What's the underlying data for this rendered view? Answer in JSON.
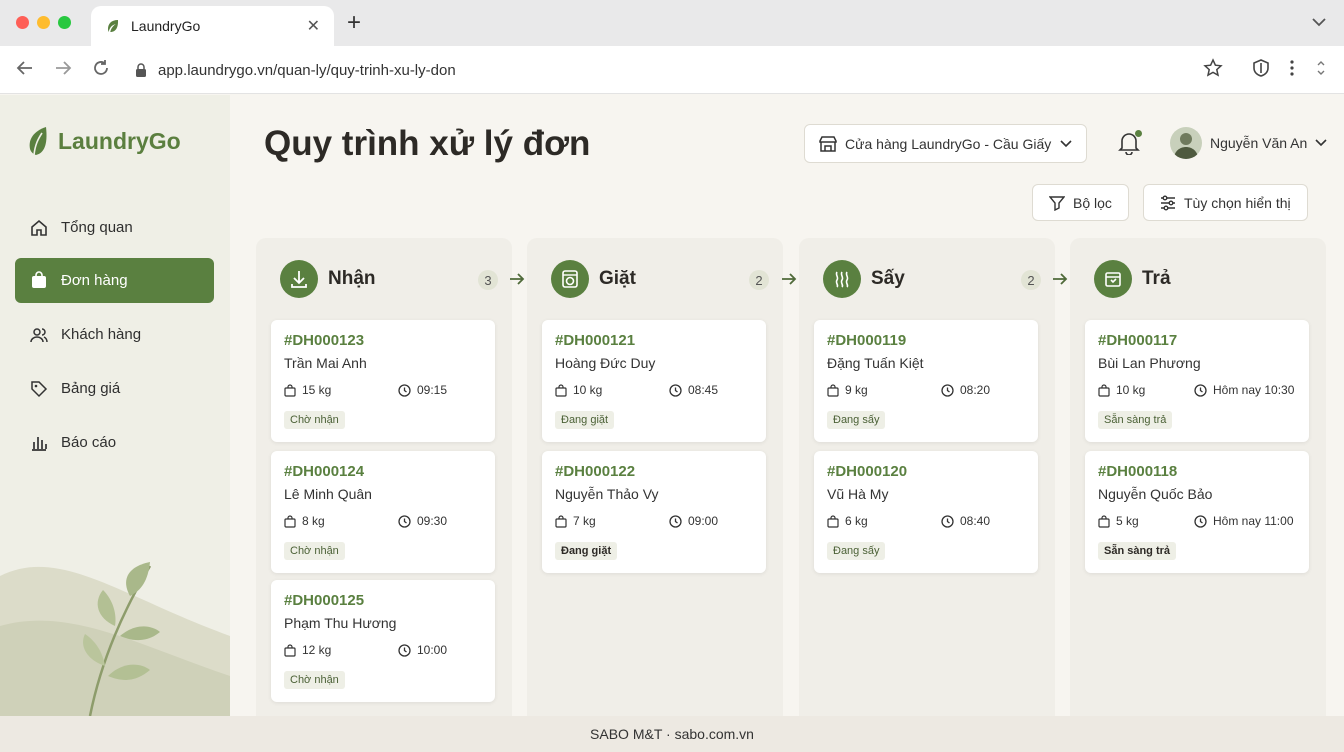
{
  "browser": {
    "tab_title": "LaundryGo",
    "url": "app.laundrygo.vn/quan-ly/quy-trinh-xu-ly-don"
  },
  "sidebar": {
    "logo": "LaundryGo",
    "items": [
      {
        "label": "Tổng quan",
        "icon": "home-icon"
      },
      {
        "label": "Đơn hàng",
        "icon": "bag-icon",
        "active": true
      },
      {
        "label": "Khách hàng",
        "icon": "users-icon"
      },
      {
        "label": "Bảng giá",
        "icon": "tag-icon"
      },
      {
        "label": "Báo cáo",
        "icon": "bar-chart-icon"
      }
    ]
  },
  "header": {
    "title": "Quy trình xử lý đơn",
    "store": "Cửa hàng LaundryGo - Cầu Giấy",
    "user": "Nguyễn Văn An",
    "filter_label": "Bộ lọc",
    "display_label": "Tùy chọn hiển thị"
  },
  "columns": [
    {
      "name": "Nhận",
      "count": "3",
      "icon": "download-icon",
      "cards": [
        {
          "code": "#DH000123",
          "customer": "Trần Mai Anh",
          "weight": "15 kg",
          "time": "09:15",
          "status": "Chờ nhận"
        },
        {
          "code": "#DH000124",
          "customer": "Lê Minh Quân",
          "weight": "8 kg",
          "time": "09:30",
          "status": "Chờ nhận"
        },
        {
          "code": "#DH000125",
          "customer": "Phạm Thu Hương",
          "weight": "12 kg",
          "time": "10:00",
          "status": "Chờ nhận"
        }
      ]
    },
    {
      "name": "Giặt",
      "count": "2",
      "icon": "washer-icon",
      "cards": [
        {
          "code": "#DH000121",
          "customer": "Hoàng Đức Duy",
          "weight": "10 kg",
          "time": "08:45",
          "status": "Đang giặt"
        },
        {
          "code": "#DH000122",
          "customer": "Nguyễn Thảo Vy",
          "weight": "7 kg",
          "time": "09:00",
          "status": "Đang giặt"
        }
      ]
    },
    {
      "name": "Sấy",
      "count": "2",
      "icon": "heat-icon",
      "cards": [
        {
          "code": "#DH000119",
          "customer": "Đặng Tuấn Kiệt",
          "weight": "9 kg",
          "time": "08:20",
          "status": "Đang sấy"
        },
        {
          "code": "#DH000120",
          "customer": "Vũ Hà My",
          "weight": "6 kg",
          "time": "08:40",
          "status": "Đang sấy"
        }
      ]
    },
    {
      "name": "Trả",
      "count": "",
      "icon": "box-icon",
      "cards": [
        {
          "code": "#DH000117",
          "customer": "Bùi Lan Phương",
          "weight": "10 kg",
          "time": "Hôm nay 10:30",
          "status": "Sẵn sàng trả"
        },
        {
          "code": "#DH000118",
          "customer": "Nguyễn Quốc Bảo",
          "weight": "5 kg",
          "time": "Hôm nay 11:00",
          "status": "Sẵn sàng trả"
        }
      ]
    }
  ],
  "footer": "SABO M&T · sabo.com.vn",
  "colors": {
    "accent": "#5a8040",
    "background": "#f7f5f0",
    "sidebar": "#efefe6"
  }
}
